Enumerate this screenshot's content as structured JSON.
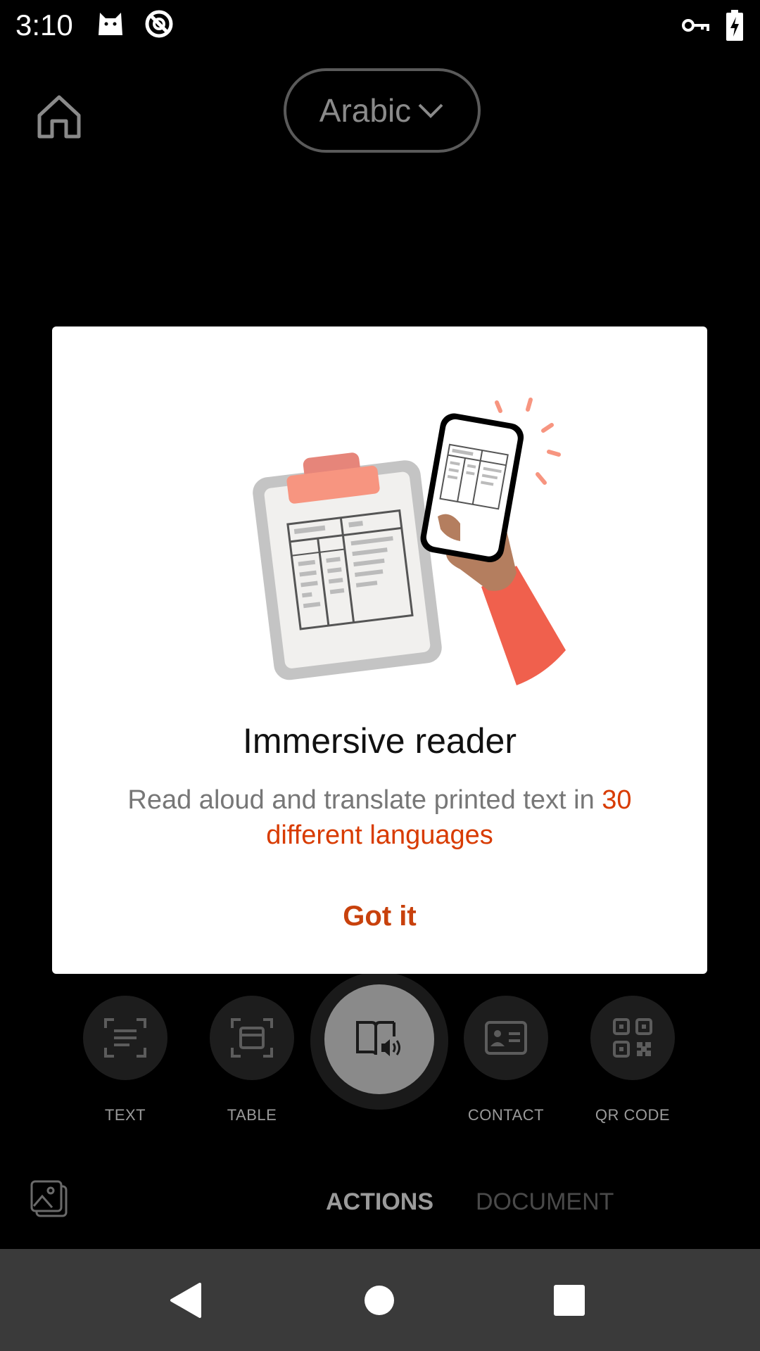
{
  "status_bar": {
    "time": "3:10"
  },
  "top": {
    "language": "Arabic"
  },
  "dialog": {
    "title": "Immersive reader",
    "description_plain": "Read aloud and translate printed text in ",
    "description_highlight": "30 different languages",
    "button": "Got it"
  },
  "modes": [
    {
      "label": "TEXT",
      "icon": "text-scan-icon"
    },
    {
      "label": "TABLE",
      "icon": "table-scan-icon"
    },
    {
      "label": "",
      "icon": "immersive-reader-icon"
    },
    {
      "label": "CONTACT",
      "icon": "contact-card-icon"
    },
    {
      "label": "QR CODE",
      "icon": "qr-code-icon"
    }
  ],
  "tabs": {
    "actions": "ACTIONS",
    "document": "DOCUMENT"
  },
  "colors": {
    "accent": "#d83b01",
    "dialog_bg": "#ffffff",
    "background": "#000000"
  }
}
